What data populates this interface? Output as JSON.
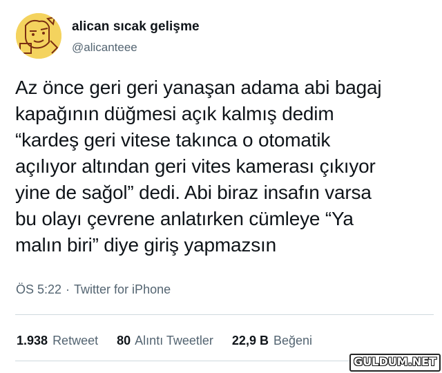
{
  "author": {
    "display_name": "alican sıcak gelişme",
    "handle": "@alicanteee",
    "avatar_icon": "cartoon-character-avatar"
  },
  "tweet": {
    "lines": [
      "Az önce geri geri yanaşan adama abi bagaj",
      "kapağının düğmesi açık kalmış dedim",
      "“kardeş geri vitese takınca o otomatik",
      "açılıyor altından geri vites kamerası çıkıyor",
      "yine de sağol” dedi. Abi biraz insafın varsa",
      "bu olayı çevrene anlatırken cümleye “Ya",
      "malın biri” diye giriş yapmazsın"
    ],
    "time": "ÖS 5:22",
    "separator": "·",
    "source": "Twitter for iPhone"
  },
  "stats": {
    "retweets_count": "1.938",
    "retweets_label": "Retweet",
    "quotes_count": "80",
    "quotes_label": "Alıntı Tweetler",
    "likes_count": "22,9 B",
    "likes_label": "Beğeni"
  },
  "watermark": "GULDUM.NET",
  "colors": {
    "text": "#0f1419",
    "secondary": "#536471",
    "divider": "#cfd9de",
    "avatar_bg": "#f4d35e"
  }
}
